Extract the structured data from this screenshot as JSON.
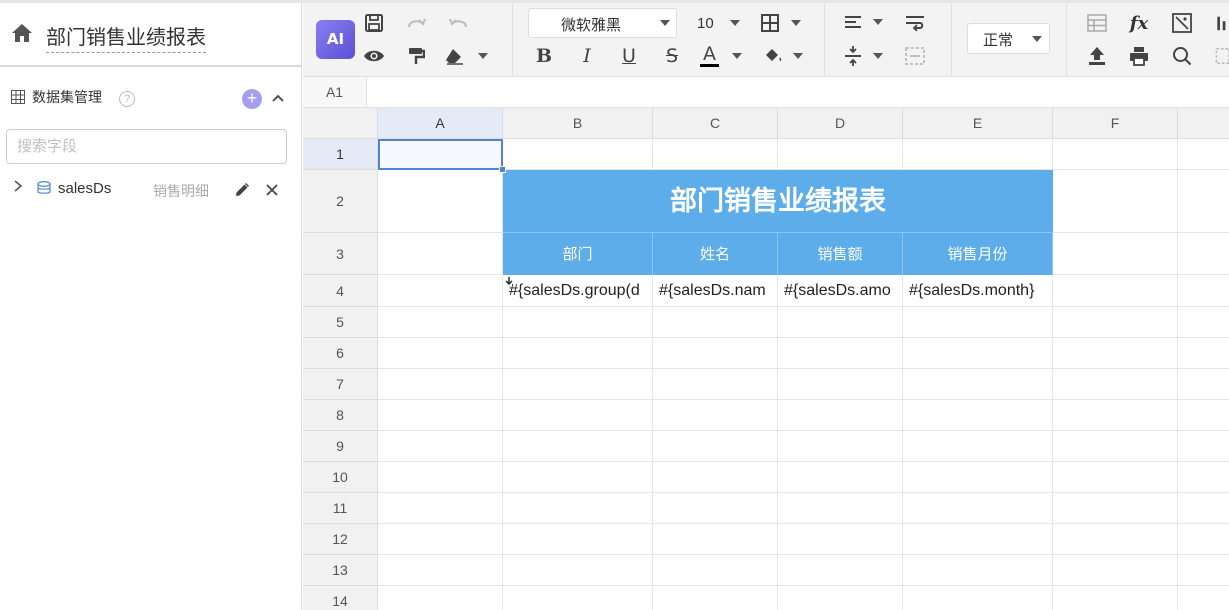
{
  "left_panel": {
    "report_title": "部门销售业绩报表",
    "dataset_section_title": "数据集管理",
    "help_glyph": "?",
    "add_glyph": "+",
    "search_placeholder": "搜索字段",
    "datasets": [
      {
        "name": "salesDs",
        "description": "销售明细"
      }
    ]
  },
  "toolbar": {
    "ai_label": "AI",
    "font_family": "微软雅黑",
    "font_size": "10",
    "bold_label": "B",
    "italic_label": "I",
    "underline_label": "U",
    "strike_label": "S",
    "font_color_label": "A",
    "number_format": "正常",
    "function_label": "fx",
    "accent_color": "#5b4fd6",
    "font_color_underline": "#000000"
  },
  "formula_bar": {
    "cell_ref": "A1",
    "value": ""
  },
  "sheet": {
    "columns": [
      "A",
      "B",
      "C",
      "D",
      "E",
      "F"
    ],
    "rows": [
      "1",
      "2",
      "3",
      "4",
      "5",
      "6",
      "7",
      "8",
      "9",
      "10",
      "11",
      "12",
      "13",
      "14"
    ],
    "selected_cell": "A1",
    "header_fill_color": "#5dadeb",
    "title": "部门销售业绩报表",
    "headers": [
      "部门",
      "姓名",
      "销售额",
      "销售月份"
    ],
    "expressions": [
      "#{salesDs.group(d",
      "#{salesDs.nam",
      "#{salesDs.amo",
      "#{salesDs.month}"
    ]
  }
}
